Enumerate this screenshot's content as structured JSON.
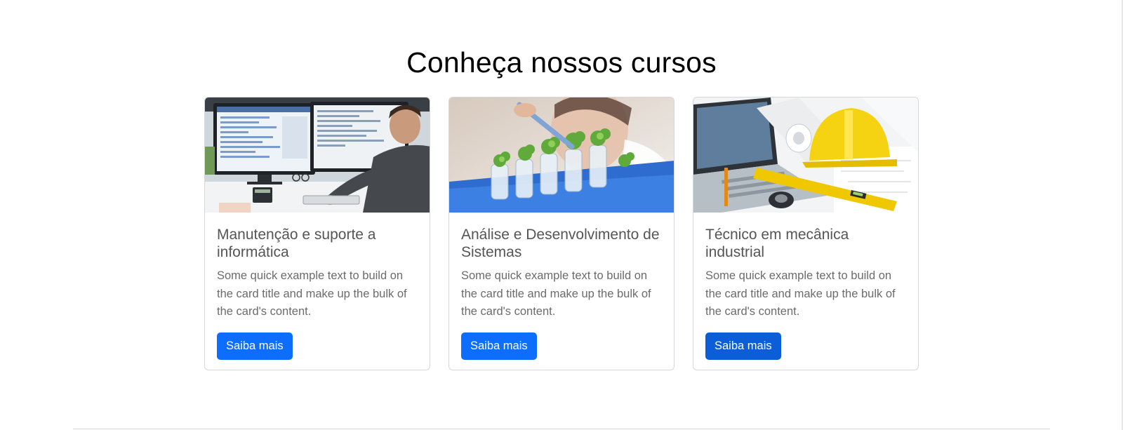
{
  "section": {
    "title": "Conheça nossos cursos"
  },
  "courses": [
    {
      "image_icon": "computer-monitors-image",
      "title": "Manutenção e suporte a informática",
      "text": "Some quick example text to build on the card title and make up the bulk of the card's content.",
      "button_label": "Saiba mais"
    },
    {
      "image_icon": "lab-plants-image",
      "title": "Análise e Desenvolvimento de Sistemas",
      "text": "Some quick example text to build on the card title and make up the bulk of the card's content.",
      "button_label": "Saiba mais"
    },
    {
      "image_icon": "engineering-tools-image",
      "title": "Técnico em mecânica industrial",
      "text": "Some quick example text to build on the card title and make up the bulk of the card's content.",
      "button_label": "Saiba mais"
    }
  ],
  "colors": {
    "primary_button": "#0d6efd",
    "primary_button_hover": "#0b5ed7",
    "card_border": "#d5d7da",
    "title_text": "#000000"
  }
}
